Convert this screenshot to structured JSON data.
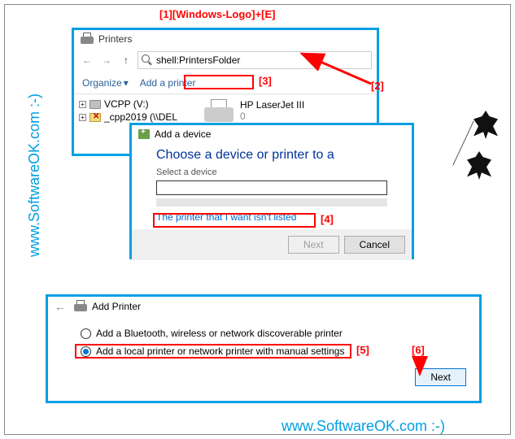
{
  "annot": {
    "step1": "[1][Windows-Logo]+[E]",
    "step2": "[2]",
    "step3": "[3]",
    "step4": "[4]",
    "step5": "[5]",
    "step6": "[6]"
  },
  "watermark": "www.SoftwareOK.com :-)",
  "win1": {
    "title": "Printers",
    "addr": "shell:PrintersFolder",
    "toolbar_organize": "Organize",
    "toolbar_add": "Add a printer",
    "tree": {
      "vcpp": "VCPP (V:)",
      "cpp": "_cpp2019 (\\\\DEL"
    },
    "printer_name": "HP LaserJet III",
    "printer_count": "0"
  },
  "win2": {
    "title": "Add a device",
    "heading": "Choose a device or printer to a",
    "sub": "Select a device",
    "link": "The printer that I want isn't listed",
    "next": "Next",
    "cancel": "Cancel"
  },
  "win3": {
    "title": "Add Printer",
    "opt1": "Add a Bluetooth, wireless or network discoverable printer",
    "opt2": "Add a local printer or network printer with manual settings",
    "next": "Next"
  }
}
